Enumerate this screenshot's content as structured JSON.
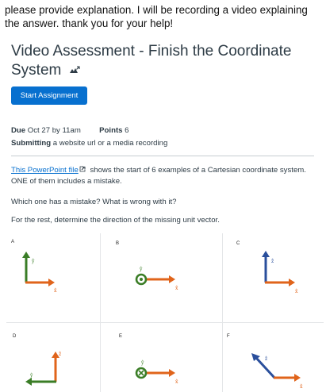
{
  "question_text": "please provide explanation. I will be recording a video explaining the answer. thank you for your help!",
  "assignment": {
    "title": "Video Assessment - Finish the Coordinate System",
    "title_icon": "external-tool-icon",
    "start_button": "Start Assignment"
  },
  "details": {
    "due_label": "Due",
    "due_value": "Oct 27 by 11am",
    "points_label": "Points",
    "points_value": "6",
    "submitting_label": "Submitting",
    "submitting_value": "a website url or a media recording"
  },
  "description": {
    "link_text": "This PowerPoint file",
    "link_icon": "file-link-icon",
    "p1_rest": "shows the start of 6 examples of a Cartesian coordinate system. ONE of them includes a mistake.",
    "p2": "Which one has a mistake? What is wrong with it?",
    "p3": "For the rest, determine the direction of the missing unit vector."
  },
  "diagrams": [
    {
      "label": "A",
      "v1": "ŷ",
      "v2": "x̂"
    },
    {
      "label": "B",
      "v1": "ŷ",
      "v2": "x̂"
    },
    {
      "label": "C",
      "v1": "ẑ",
      "v2": "x̂"
    },
    {
      "label": "D",
      "v1": "ẑ",
      "v2": "ŷ"
    },
    {
      "label": "E",
      "v1": "ŷ",
      "v2": "x̂"
    },
    {
      "label": "F",
      "v1": "ẑ",
      "v2": "x̂"
    }
  ],
  "colors": {
    "green": "#3a7d26",
    "orange": "#e0641b",
    "blue": "#2a4f9c",
    "accent": "#0770cf",
    "text": "#2d3b45"
  }
}
